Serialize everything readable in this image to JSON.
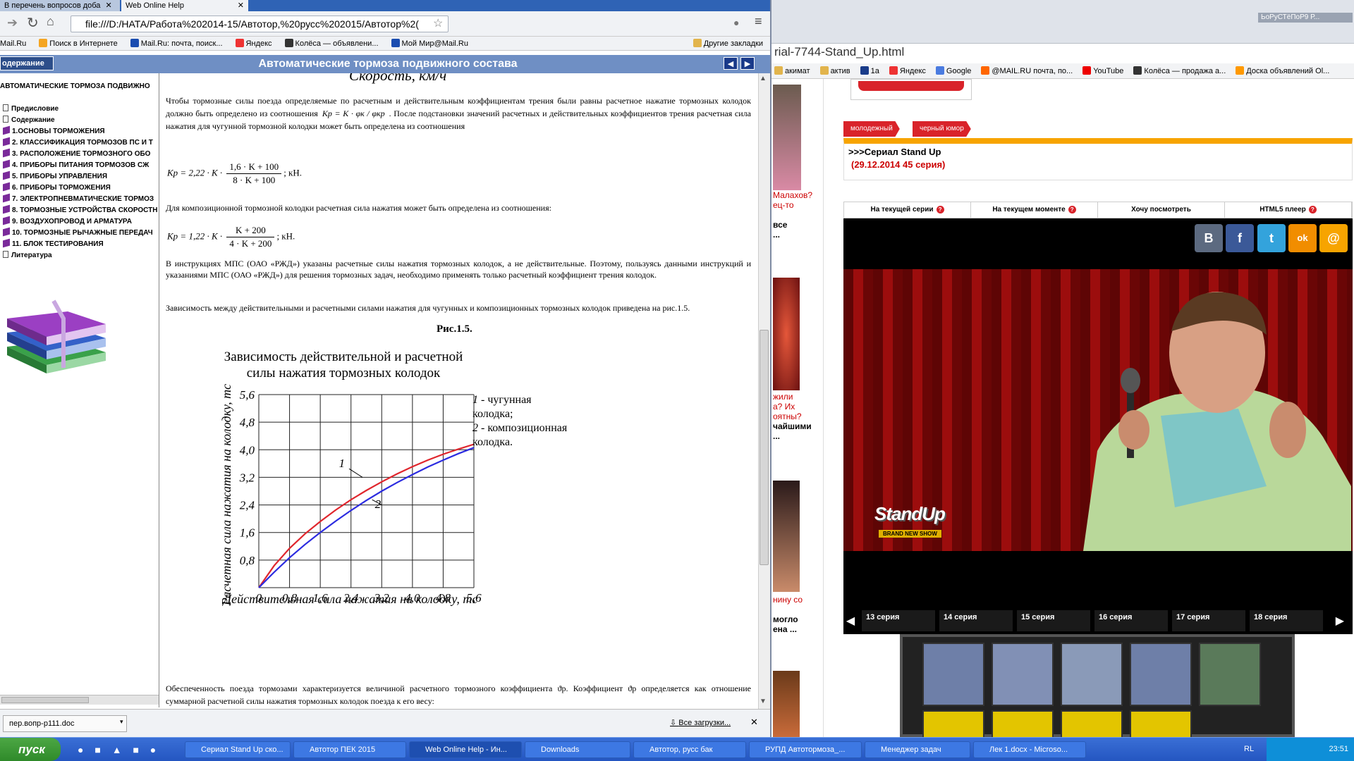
{
  "fg_browser": {
    "tabs": [
      "В перечень вопросов доба",
      "Web Online Help"
    ],
    "address": "file:///D:/НАТА/Работа%202014-15/Автотор,%20русс%202015/Автотор%2(",
    "bookmarks": [
      "Mail.Ru",
      "Поиск в Интернете",
      "Mail.Ru: почта, поиск...",
      "Яндекс",
      "Колёса — объявлени...",
      "Мой Мир@Mail.Ru"
    ],
    "other_bookmarks": "Другие закладки",
    "download_file": "пер.вопр-р111.doc",
    "all_downloads": "Все загрузки..."
  },
  "help": {
    "contents_button": "одержание",
    "title": "Автоматические тормоза подвижного состава",
    "toc_root": "АВТОМАТИЧЕСКИЕ ТОРМОЗА ПОДВИЖНО",
    "toc": [
      {
        "label": "Предисловие",
        "type": "page"
      },
      {
        "label": "Содержание",
        "type": "page"
      },
      {
        "label": "1.ОСНОВЫ ТОРМОЖЕНИЯ",
        "type": "book"
      },
      {
        "label": "2. КЛАССИФИКАЦИЯ ТОРМОЗОВ ПС И Т",
        "type": "book"
      },
      {
        "label": "3. РАСПОЛОЖЕНИЕ ТОРМОЗНОГО ОБО",
        "type": "book"
      },
      {
        "label": "4. ПРИБОРЫ ПИТАНИЯ ТОРМОЗОВ СЖ",
        "type": "book"
      },
      {
        "label": "5. ПРИБОРЫ УПРАВЛЕНИЯ",
        "type": "book"
      },
      {
        "label": "6. ПРИБОРЫ ТОРМОЖЕНИЯ",
        "type": "book"
      },
      {
        "label": "7. ЭЛЕКТРОПНЕВМАТИЧЕСКИЕ ТОРМОЗ",
        "type": "book"
      },
      {
        "label": "8. ТОРМОЗНЫЕ УСТРОЙСТВА СКОРОСТН",
        "type": "book"
      },
      {
        "label": "9. ВОЗДУХОПРОВОД И АРМАТУРА",
        "type": "book"
      },
      {
        "label": "10. ТОРМОЗНЫЕ РЫЧАЖНЫЕ ПЕРЕДАЧ",
        "type": "book"
      },
      {
        "label": "11. БЛОК ТЕСТИРОВАНИЯ",
        "type": "book"
      },
      {
        "label": "Литература",
        "type": "page"
      }
    ],
    "top_cut_label": "Скорость, км/ч",
    "para1a": "Чтобы тормозные силы поезда определяемые по расчетным и действительным коэффициентам трения были равны расчетное нажатие тормозных колодок должно быть определено из соотношения",
    "para1b": ". После подстановки значений расчетных и действительных коэффициентов трения расчетная сила нажатия для чугунной тормозной колодки может быть определена из соотношения",
    "eq0": "Kр = K · φк / φкр",
    "eq1_lhs": "Kр = 2,22 · K ·",
    "eq1_num": "1,6 · K + 100",
    "eq1_den": "8 · K + 100",
    "eq1_unit": "; кН.",
    "para2": "Для композиционной тормозной колодки расчетная сила нажатия может быть определена из соотношения:",
    "eq2_lhs": "Kр = 1,22 · K ·",
    "eq2_num": "K + 200",
    "eq2_den": "4 · K + 200",
    "eq2_unit": "; кН.",
    "para3": "В инструкциях МПС (ОАО «РЖД») указаны расчетные силы нажатия тормозных колодок, а не действительные. Поэтому, пользуясь данными инструкций и указаниями МПС (ОАО «РЖД») для решения тормозных задач, необходимо применять только расчетный коэффициент трения колодок.",
    "para4": "Зависимость между действительными и расчетными силами нажатия для чугунных и композиционных тормозных колодок приведена на рис.1.5.",
    "fig_caption": "Рис.1.5.",
    "para5": "Обеспеченность поезда тормозами характеризуется величиной расчетного тормозного коэффициента ϑр. Коэффициент ϑр определяется как отношение суммарной расчетной силы нажатия тормозных колодок поезда к его весу:"
  },
  "chart_data": {
    "type": "line",
    "title": "Зависимость действительной и расчетной силы нажатия тормозных колодок",
    "xlabel": "Действительная сила нажатия на колодку, тс",
    "ylabel": "Расчетная сила нажатия на колодку, тс",
    "xlim": [
      0,
      5.6
    ],
    "ylim": [
      0,
      5.6
    ],
    "x_ticks": [
      "0",
      "0,8",
      "1,6",
      "2,4",
      "3,2",
      "4,0",
      "4,8",
      "5,6"
    ],
    "y_ticks": [
      "0,8",
      "1,6",
      "2,4",
      "3,2",
      "4,0",
      "4,8",
      "5,6"
    ],
    "grid": true,
    "legend": [
      "1 - чугунная колодка;",
      "2 - композиционная колодка."
    ],
    "series": [
      {
        "name": "1",
        "color": "#e0262d",
        "x": [
          0,
          0.4,
          0.8,
          1.2,
          1.6,
          2.0,
          2.4,
          2.8,
          3.2,
          3.6,
          4.0,
          4.4,
          4.8,
          5.2,
          5.6
        ],
        "y": [
          0,
          0.64,
          1.14,
          1.56,
          1.92,
          2.25,
          2.55,
          2.82,
          3.07,
          3.3,
          3.51,
          3.7,
          3.87,
          4.02,
          4.16
        ]
      },
      {
        "name": "2",
        "color": "#2c2ce0",
        "x": [
          0,
          0.4,
          0.8,
          1.2,
          1.6,
          2.0,
          2.4,
          2.8,
          3.2,
          3.6,
          4.0,
          4.4,
          4.8,
          5.2,
          5.6
        ],
        "y": [
          0,
          0.45,
          0.87,
          1.25,
          1.6,
          1.93,
          2.24,
          2.53,
          2.8,
          3.05,
          3.28,
          3.5,
          3.7,
          3.89,
          4.06
        ]
      }
    ],
    "curve_labels": [
      "1",
      "2"
    ]
  },
  "bg_browser": {
    "url_fragment": "rial-7744-Stand_Up.html",
    "top_right_text": "ЬоРуСТёПоР9 Р...",
    "bookmarks": [
      "акимат",
      "актив",
      "1а",
      "Яндекс",
      "Google",
      "@MAIL.RU почта, по...",
      "YouTube",
      "Колёса — продажа а...",
      "Доска объявлений Ol..."
    ],
    "left_snippets": [
      "Малахов?",
      "ец-то",
      "все",
      "...",
      "жили",
      "а? Их",
      "оятны?",
      "чайшими",
      "...",
      "нину со",
      "могло",
      "ена ..."
    ],
    "tags": [
      "молодежный",
      "черный юмор"
    ],
    "announce_title": ">>>Сериал Stand Up",
    "announce_date": "(29.12.2014 45 серия)",
    "tabs": [
      "На текущей серии",
      "На текущем моменте",
      "Хочу посмотреть",
      "HTML5 плеер"
    ],
    "share": [
      "B",
      "f",
      "t",
      "ok",
      "@"
    ],
    "episodes": [
      "13 серия",
      "14 серия",
      "15 серия",
      "16 серия",
      "17 серия",
      "18 серия"
    ],
    "video_logo": "StandUp",
    "video_logo_sub": "BRAND NEW SHOW"
  },
  "taskbar": {
    "start": "пуск",
    "buttons": [
      "Сериал Stand Up ско...",
      "Автотор ПЕК 2015",
      "Web Online Help - Ин...",
      "Downloads",
      "Автотор, русс бак",
      "РУПД Автотормоза_...",
      "Менеджер задач",
      "Лек 1.docx - Microso..."
    ],
    "lang": "RL",
    "time": "23:51"
  }
}
